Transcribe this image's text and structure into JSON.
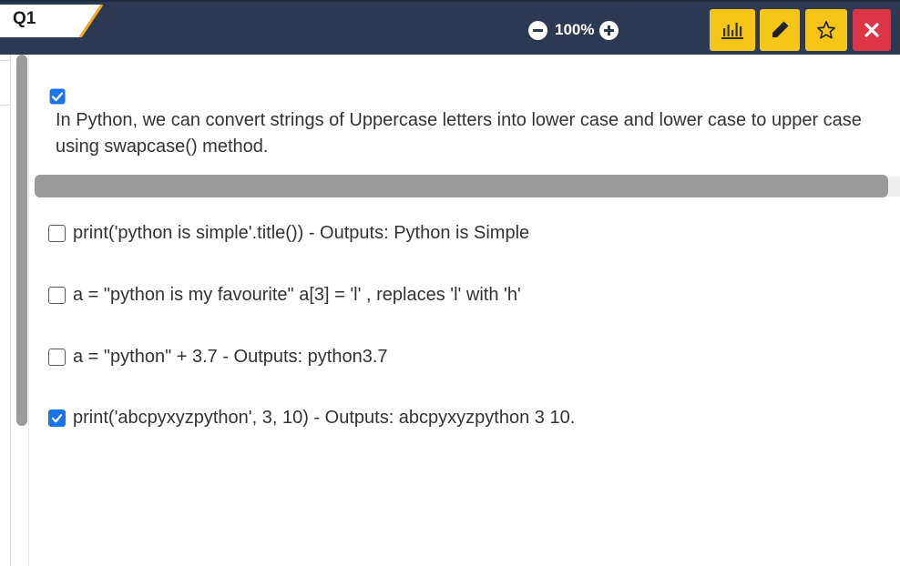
{
  "header": {
    "question_tab": "Q1",
    "zoom": "100%",
    "icons": {
      "zoom_out": "minus-circle-icon",
      "zoom_in": "plus-circle-icon",
      "chart": "bar-chart-icon",
      "edit": "pencil-icon",
      "bookmark": "star-icon",
      "close": "close-icon"
    },
    "colors": {
      "bar": "#2b3a52",
      "tab_accent": "#f5a623",
      "action": "#f5c518",
      "close": "#dc3545"
    }
  },
  "question": {
    "checked": true,
    "text": "In Python, we can convert strings of Uppercase letters into lower case and lower case to upper case using swapcase() method."
  },
  "options": [
    {
      "label": "print('python is simple'.title()) - Outputs: Python is Simple",
      "checked": false
    },
    {
      "label": "a = \"python is my favourite\" a[3] = 'l' , replaces 'l' with 'h'",
      "checked": false
    },
    {
      "label": "a = \"python\" + 3.7 - Outputs: python3.7",
      "checked": false
    },
    {
      "label": "print('abcpyxyzpython', 3, 10) - Outputs: abcpyxyzpython 3 10.",
      "checked": true
    }
  ]
}
